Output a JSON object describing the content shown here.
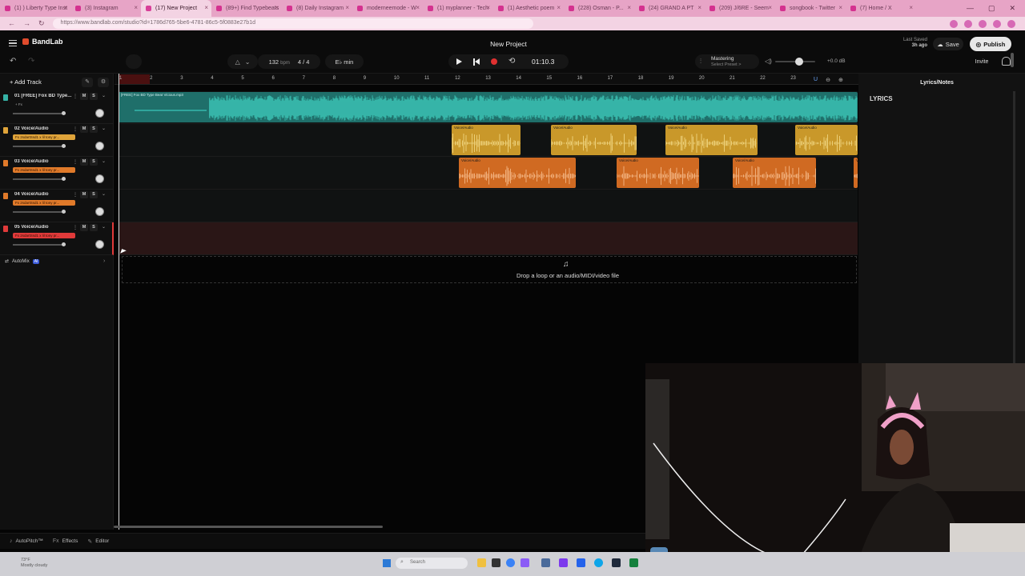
{
  "browser": {
    "tabs": [
      {
        "title": "(1) ) Liberty Type Inst"
      },
      {
        "title": "(3) Instagram"
      },
      {
        "title": "(17) New Project"
      },
      {
        "title": "(89+) Find Typebeats"
      },
      {
        "title": "(8) Daily Instagram"
      },
      {
        "title": "moderneemode - W"
      },
      {
        "title": "(1) myplanner - Tech"
      },
      {
        "title": "(1) Aesthetic poem"
      },
      {
        "title": "(228) Osman - P..."
      },
      {
        "title": "(24) GRAND A PT"
      },
      {
        "title": "(209) J/6RE - Seem"
      },
      {
        "title": "songbook - Twitter"
      },
      {
        "title": "(7) Home / X"
      }
    ],
    "active_tab_index": 2,
    "url": "https://www.bandlab.com/studio?id=1786d765-5be6-4781-86c5-5f0883e27b1d"
  },
  "app": {
    "logo": "BandLab",
    "project_title": "New Project",
    "last_saved_label": "Last Saved",
    "last_saved_time": "3h ago",
    "save_label": "Save",
    "publish_label": "Publish",
    "invite_label": "Invite",
    "bpm": "132",
    "bpm_unit": "bpm",
    "time_signature": "4 / 4",
    "key": "E♭ min",
    "time": "01:10.3",
    "mastering_label": "Mastering",
    "mastering_preset": "Select Preset >",
    "volume_db": "+0.0 dB",
    "volume_level": 0.6
  },
  "left_panel": {
    "add_track_label": "Add Track",
    "tracks": [
      {
        "name": "01  [FREE] Fox BD Type...",
        "fx": "+ Fx",
        "color": "#36b3a6"
      },
      {
        "name": "02  Voice/Audio",
        "fx": "Fx  2sdartSsd1 x lil tony pr...",
        "color": "#e0a43a"
      },
      {
        "name": "03  Voice/Audio",
        "fx": "Fx  2sdartSsd1 x lil tony pr...",
        "color": "#e07a2a"
      },
      {
        "name": "04  Voice/Audio",
        "fx": "Fx  2sdartSsd1 x lil tony pr...",
        "color": "#e07a2a"
      },
      {
        "name": "05  Voice/Audio",
        "fx": "Fx  2sdartSsd1 x lil tony pr...",
        "color": "#e03a3a"
      }
    ],
    "mute_label": "M",
    "solo_label": "S",
    "automix_label": "AutoMix",
    "automix_badge": "AI"
  },
  "timeline": {
    "bars": [
      "1",
      "2",
      "3",
      "4",
      "5",
      "6",
      "7",
      "8",
      "9",
      "10",
      "11",
      "12",
      "13",
      "14",
      "15",
      "16",
      "17",
      "18",
      "19",
      "20",
      "21",
      "22",
      "23"
    ],
    "clip_track1_label": "[FREE] Fox BD Type Beat Vicious.mp3",
    "clip_voice_label": "Voice/Audio",
    "drop_text": "Drop a loop or an audio/MIDI/video file"
  },
  "right_panel": {
    "title": "Lyrics/Notes",
    "lyrics_heading": "LYRICS"
  },
  "bottom_bar": {
    "autopitch": "AutoPitch™",
    "effects": "Effects",
    "editor": "Editor"
  },
  "taskbar": {
    "weather_temp": "73°F",
    "weather_desc": "Mostly cloudy",
    "search_placeholder": "Search"
  },
  "colors": {
    "teal": "#36b3a6",
    "gold": "#d9a32e",
    "orange": "#e07a2a",
    "red_track": "#e03a3a",
    "record": "#e03030"
  }
}
